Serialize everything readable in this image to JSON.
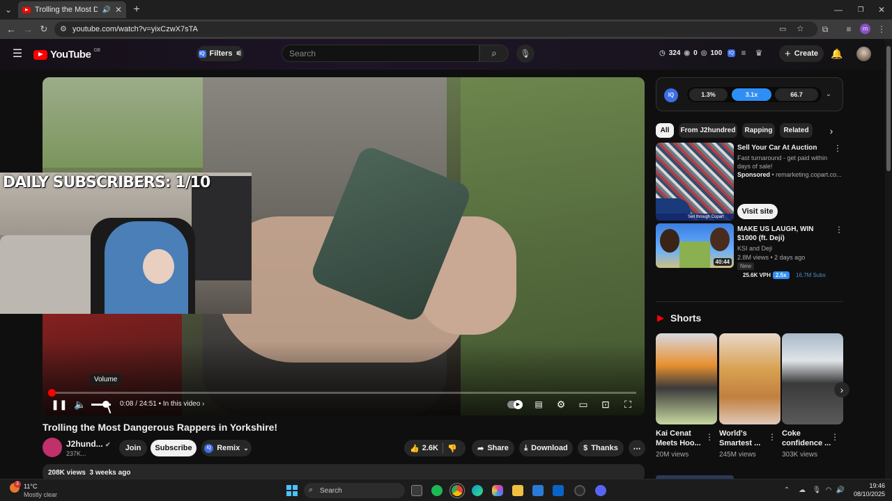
{
  "browser": {
    "tab_title": "Trolling the Most Dangerou",
    "url": "youtube.com/watch?v=yixCzwX7sTA"
  },
  "header": {
    "logo": "YouTube",
    "region": "GB",
    "filters_label": "Filters",
    "search_placeholder": "Search",
    "stat_a": "324",
    "stat_b": "0",
    "stat_c": "100",
    "create_label": "Create"
  },
  "video": {
    "overlay_text": "DAILY SUBSCRIBERS: 1/10",
    "volume_tooltip": "Volume",
    "current_time": "0:08",
    "duration": "24:51",
    "chapter_link": "In this video",
    "progress_fraction": 0.005,
    "title": "Trolling the Most Dangerous Rappers in Yorkshire!",
    "channel": "J2hund...",
    "subscribers": "237K...",
    "join_label": "Join",
    "subscribe_label": "Subscribe",
    "remix_label": "Remix",
    "likes": "2.6K",
    "share_label": "Share",
    "download_label": "Download",
    "thanks_label": "Thanks",
    "views": "208K views",
    "age": "3 weeks ago"
  },
  "sidebar": {
    "iq_stats": [
      "1.3%",
      "3.1x",
      "66.7"
    ],
    "chips": [
      "All",
      "From J2hundred",
      "Rapping",
      "Related"
    ],
    "ad": {
      "title": "Sell Your Car At Auction",
      "desc": "Fast turnaround - get paid within days of sale!",
      "sponsored": "Sponsored",
      "domain": "remarketing.copart.co...",
      "cta": "Visit site",
      "thumb_caption": "Sell through Copart"
    },
    "rec": {
      "title": "MAKE US LAUGH, WIN $1000 (ft. Deji)",
      "channel": "KSI and Deji",
      "meta": "2.8M views • 2 days ago",
      "badge": "New",
      "duration": "40:44",
      "vph": "25.6K VPH",
      "multiplier": "2.5x",
      "subs": "16.7M Subs"
    },
    "shorts_heading": "Shorts",
    "shorts": [
      {
        "title": "Kai Cenat Meets Hoo...",
        "views": "20M views"
      },
      {
        "title": "World's Smartest ...",
        "views": "245M views"
      },
      {
        "title": "Coke confidence ...",
        "views": "303K views"
      }
    ]
  },
  "taskbar": {
    "weather_temp": "11°C",
    "weather_desc": "Mostly clear",
    "weather_badge": "3",
    "search_label": "Search",
    "time": "19:46",
    "date": "08/10/2025"
  }
}
